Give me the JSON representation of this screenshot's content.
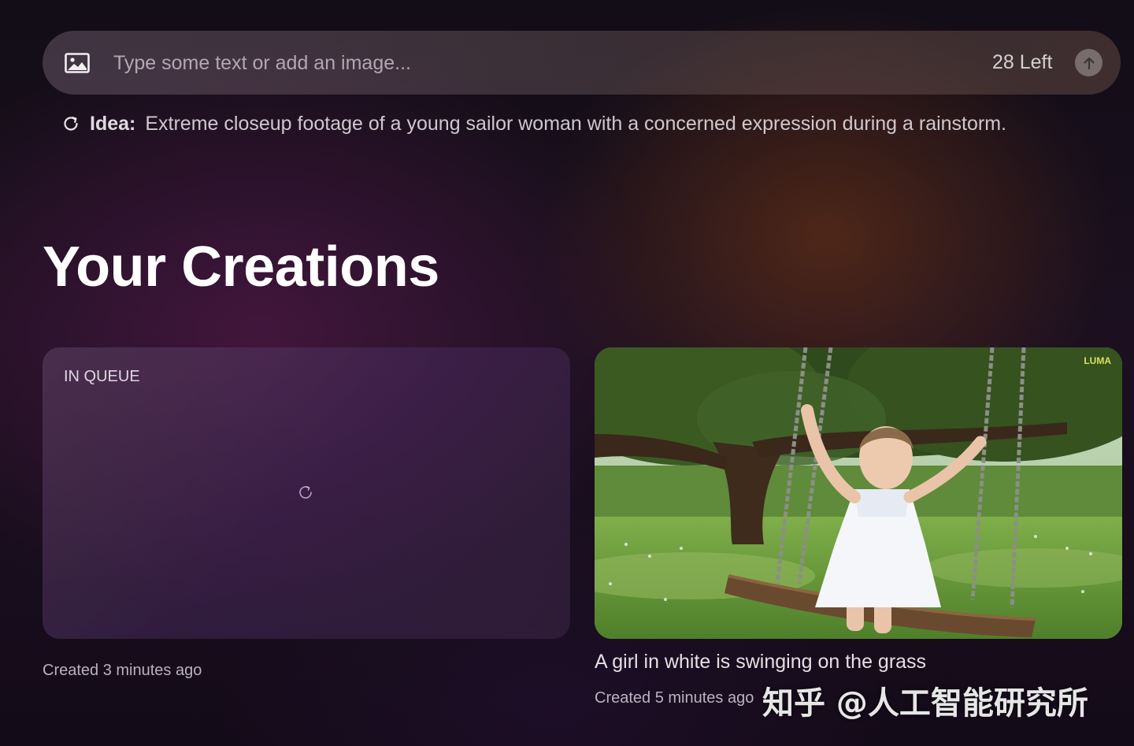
{
  "prompt": {
    "placeholder": "Type some text or add an image...",
    "remaining": "28 Left"
  },
  "idea": {
    "label": "Idea:",
    "text": "Extreme closeup footage of a young sailor woman with a concerned expression during a rainstorm."
  },
  "creations": {
    "title": "Your Creations",
    "items": [
      {
        "status": "IN QUEUE",
        "created": "Created 3 minutes ago"
      },
      {
        "title": "A girl in white is swinging on the grass",
        "created": "Created 5 minutes ago",
        "logo_text": "LUMA"
      }
    ]
  },
  "watermark": "知乎 @人工智能研究所"
}
